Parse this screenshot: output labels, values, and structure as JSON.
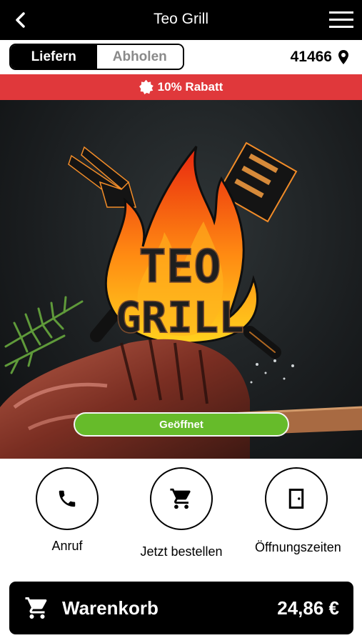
{
  "header": {
    "title": "Teo Grill"
  },
  "order_mode": {
    "delivery_label": "Liefern",
    "pickup_label": "Abholen",
    "selected": "Liefern",
    "postcode": "41466"
  },
  "promo": {
    "text": "10% Rabatt"
  },
  "hero": {
    "logo_line1": "TEO",
    "logo_line2": "GRILL",
    "status": "Geöffnet"
  },
  "actions": {
    "call_label": "Anruf",
    "order_label": "Jetzt bestellen",
    "hours_label": "Öffnungszeiten"
  },
  "cart": {
    "label": "Warenkorb",
    "total": "24,86 €"
  },
  "icons": [
    "back-icon",
    "menu-icon",
    "location-pin-icon",
    "discount-badge-icon",
    "phone-icon",
    "cart-icon",
    "door-icon"
  ],
  "colors": {
    "header_bg": "#000000",
    "promo_bg": "#e0383b",
    "status_green": "#66bb2a",
    "inactive_text": "#8a8a8a"
  }
}
